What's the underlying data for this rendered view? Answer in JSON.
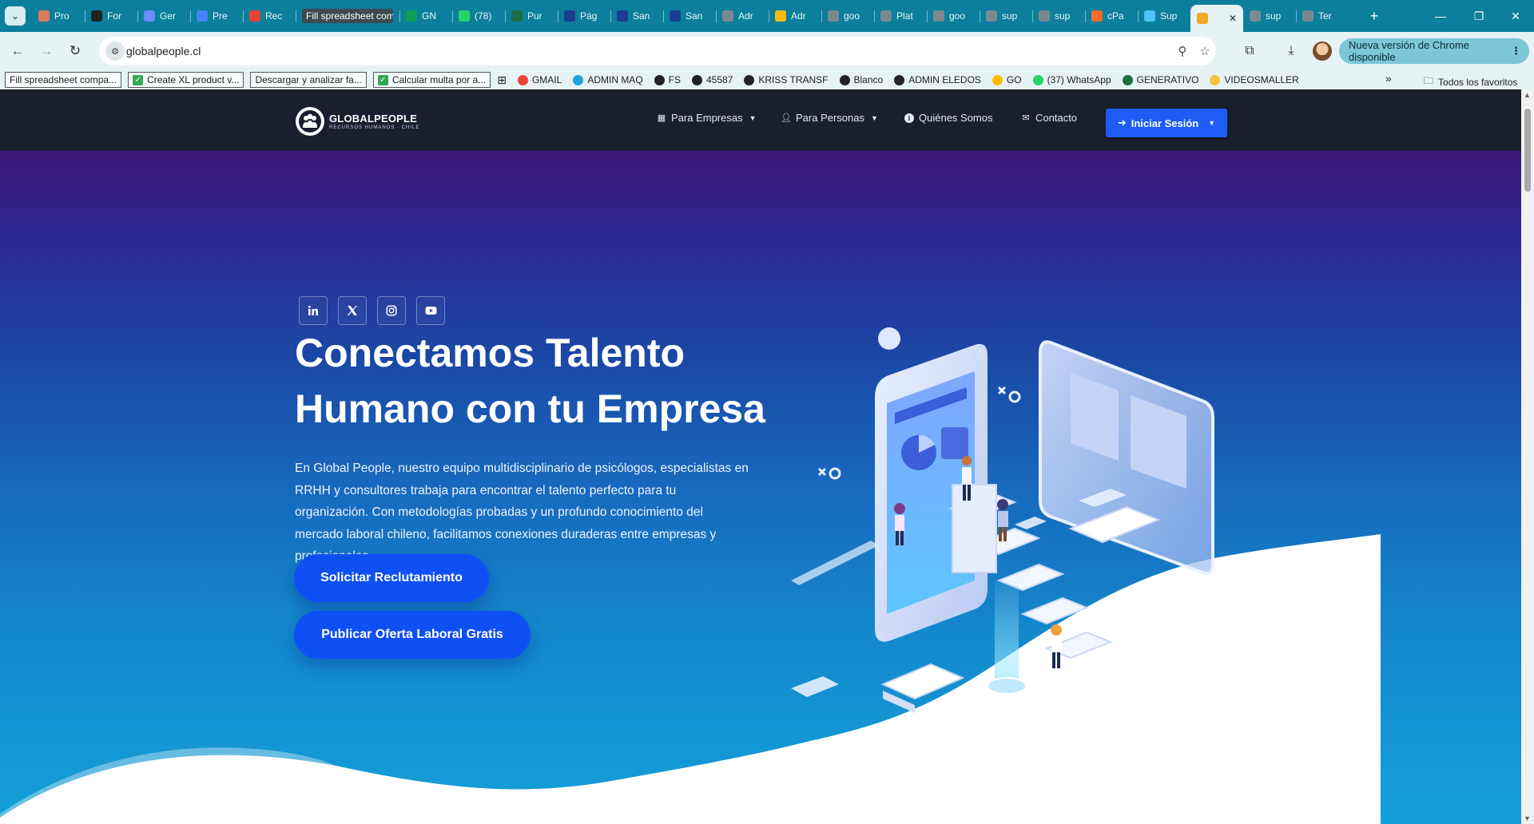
{
  "browser": {
    "tabs": [
      {
        "label": "Pro",
        "favicon": "puzzle-icon",
        "color": "#e07a5f"
      },
      {
        "label": "For",
        "favicon": "openai-icon",
        "color": "#222222"
      },
      {
        "label": "Ger",
        "favicon": "gemini-icon",
        "color": "#6b8cff"
      },
      {
        "label": "Pre",
        "favicon": "docs-icon",
        "color": "#4285f4"
      },
      {
        "label": "Rec",
        "favicon": "gmail-icon",
        "color": "#ea4335"
      },
      {
        "label": "Fill spreadsheet comp",
        "favicon": "",
        "color": "#3c4b50",
        "hover": true
      },
      {
        "label": "GN",
        "favicon": "sheets-arrow-icon",
        "color": "#0f9d58"
      },
      {
        "label": "(78)",
        "favicon": "whatsapp-icon",
        "color": "#25d366"
      },
      {
        "label": "Pur",
        "favicon": "excel-icon",
        "color": "#1d6f42"
      },
      {
        "label": "Pág",
        "favicon": "b-icon",
        "color": "#1a3d8f"
      },
      {
        "label": "San",
        "favicon": "b-icon",
        "color": "#1a3d8f"
      },
      {
        "label": "San",
        "favicon": "b-icon",
        "color": "#1a3d8f"
      },
      {
        "label": "Adr",
        "favicon": "globe-icon",
        "color": "#7c8a90"
      },
      {
        "label": "Adr",
        "favicon": "google-ads-icon",
        "color": "#fbbc04"
      },
      {
        "label": "goo",
        "favicon": "globe-icon",
        "color": "#7c8a90"
      },
      {
        "label": "Plat",
        "favicon": "globe-icon",
        "color": "#7c8a90"
      },
      {
        "label": "goo",
        "favicon": "globe-icon",
        "color": "#7c8a90"
      },
      {
        "label": "sup",
        "favicon": "globe-icon",
        "color": "#7c8a90"
      },
      {
        "label": "sup",
        "favicon": "globe-icon",
        "color": "#7c8a90"
      },
      {
        "label": "cPa",
        "favicon": "cpanel-icon",
        "color": "#ff6c2c"
      },
      {
        "label": "Sup",
        "favicon": "cloud-icon",
        "color": "#4fc3f7"
      },
      {
        "label": "",
        "favicon": "globalpeople-icon",
        "color": "#f4a62a",
        "active": true
      },
      {
        "label": "sup",
        "favicon": "globe-icon",
        "color": "#7c8a90"
      },
      {
        "label": "Ter",
        "favicon": "globe-icon",
        "color": "#7c8a90"
      }
    ],
    "url": "globalpeople.cl",
    "update_label": "Nueva versión de Chrome disponible",
    "bookmarks_boxed": [
      {
        "label": "Fill spreadsheet compa...",
        "icon": ""
      },
      {
        "label": "Create XL product v...",
        "icon": "check-icon"
      },
      {
        "label": "Descargar y analizar fa...",
        "icon": ""
      },
      {
        "label": "Calcular multa por a...",
        "icon": "check-icon"
      }
    ],
    "bookmarks": [
      {
        "label": "GMAIL",
        "icon": "gmail-icon",
        "color": "#ea4335"
      },
      {
        "label": "ADMIN MAQ",
        "icon": "snowflake-icon",
        "color": "#1fa3e0"
      },
      {
        "label": "FS",
        "icon": "globe-icon",
        "color": "#222222"
      },
      {
        "label": "45587",
        "icon": "globe-icon",
        "color": "#222222"
      },
      {
        "label": "KRISS TRANSF",
        "icon": "globe-icon",
        "color": "#222222"
      },
      {
        "label": "Blanco",
        "icon": "globe-icon",
        "color": "#222222"
      },
      {
        "label": "ADMIN ELEDOS",
        "icon": "globe-icon",
        "color": "#222222"
      },
      {
        "label": "GO",
        "icon": "google-ads-icon",
        "color": "#fbbc04"
      },
      {
        "label": "(37) WhatsApp",
        "icon": "whatsapp-icon",
        "color": "#25d366"
      },
      {
        "label": "GENERATIVO",
        "icon": "excel-icon",
        "color": "#1d6f42"
      },
      {
        "label": "VIDEOSMALLER",
        "icon": "folder-icon",
        "color": "#f5c542"
      }
    ],
    "all_bookmarks_label": "Todos los favoritos"
  },
  "site": {
    "logo_name": "GLOBALPEOPLE",
    "logo_tagline": "RECURSOS HUMANOS · CHILE",
    "nav": {
      "empresas": "Para Empresas",
      "personas": "Para Personas",
      "quienes": "Quiénes Somos",
      "contacto": "Contacto",
      "login": "Iniciar Sesión"
    },
    "socials": [
      "linkedin-icon",
      "x-icon",
      "instagram-icon",
      "youtube-icon"
    ],
    "hero": {
      "title_line1": "Conectamos Talento",
      "title_line2": "Humano con tu Empresa",
      "text": "En Global People, nuestro equipo multidisciplinario de psicólogos, especialistas en RRHH y consultores trabaja para encontrar el talento perfecto para tu organización. Con metodologías probadas y un profundo conocimiento del mercado laboral chileno, facilitamos conexiones duraderas entre empresas y profesionales.",
      "cta_primary": "Solicitar Reclutamiento",
      "cta_secondary": "Publicar Oferta Laboral Gratis"
    },
    "colors": {
      "nav_bg": "#1a1f2e",
      "accent": "#1e5cf5",
      "cta": "#0f50f5"
    }
  }
}
